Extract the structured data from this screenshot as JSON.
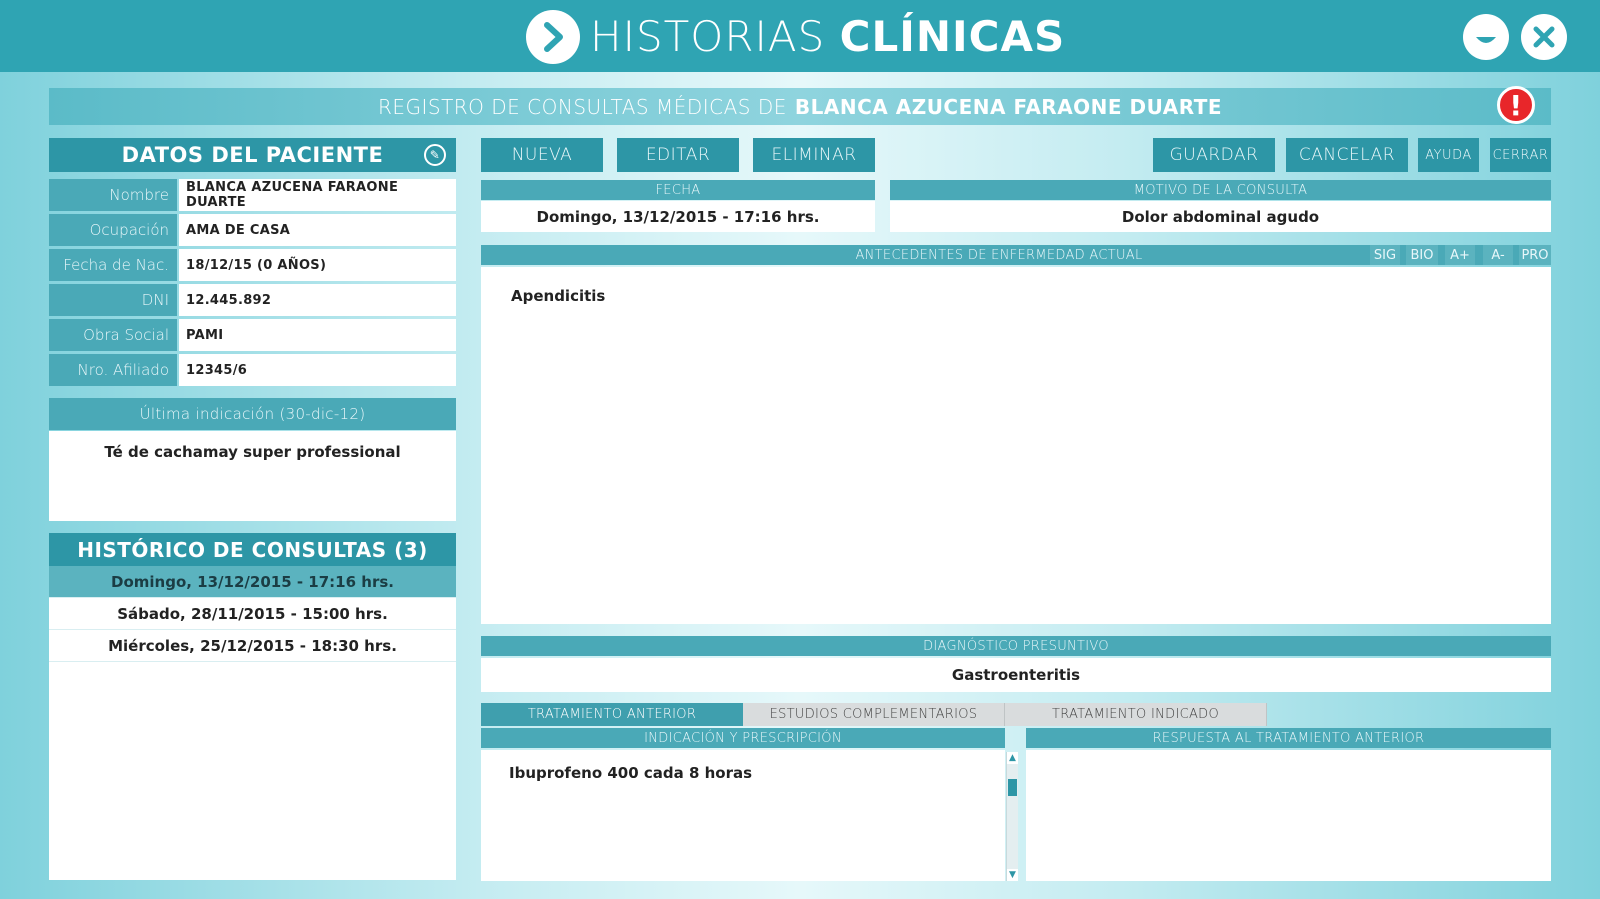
{
  "app": {
    "title_light": "HISTORIAS",
    "title_bold": "CLÍNICAS",
    "logo_icon": "chevron-right-icon",
    "minimize_icon": "minimize-icon",
    "close_icon": "close-icon"
  },
  "header": {
    "prefix": "REGISTRO DE CONSULTAS MÉDICAS DE",
    "patient_name": "BLANCA AZUCENA FARAONE DUARTE",
    "alert_symbol": "!"
  },
  "patient": {
    "title": "DATOS DEL PACIENTE",
    "fields": [
      {
        "label": "Nombre",
        "value": "BLANCA AZUCENA FARAONE DUARTE"
      },
      {
        "label": "Ocupación",
        "value": "AMA DE CASA"
      },
      {
        "label": "Fecha de Nac.",
        "value": "18/12/15 (0 AÑOS)"
      },
      {
        "label": "DNI",
        "value": "12.445.892"
      },
      {
        "label": "Obra Social",
        "value": "PAMI"
      },
      {
        "label": "Nro. Afiliado",
        "value": "12345/6"
      }
    ]
  },
  "last_indication": {
    "title": "Última indicación (30-dic-12)",
    "text": "Té de cachamay super professional"
  },
  "history": {
    "title": "HISTÓRICO DE CONSULTAS (3)",
    "items": [
      "Domingo, 13/12/2015 - 17:16 hrs.",
      "Sábado, 28/11/2015 - 15:00 hrs.",
      "Miércoles, 25/12/2015 - 18:30 hrs."
    ]
  },
  "toolbar": {
    "nueva": "NUEVA",
    "editar": "EDITAR",
    "eliminar": "ELIMINAR",
    "guardar": "GUARDAR",
    "cancelar": "CANCELAR",
    "ayuda": "AYUDA",
    "cerrar": "CERRAR"
  },
  "consulta": {
    "fecha_label": "FECHA",
    "fecha_value": "Domingo, 13/12/2015 - 17:16 hrs.",
    "motivo_label": "MOTIVO DE LA CONSULTA",
    "motivo_value": "Dolor abdominal agudo",
    "antecedentes_label": "ANTECEDENTES DE ENFERMEDAD ACTUAL",
    "antecedentes_value": "Apendicitis",
    "format_buttons": [
      "SIG",
      "BIO",
      "A+",
      "A-",
      "PRO"
    ],
    "diagnostico_label": "DIAGNÓSTICO PRESUNTIVO",
    "diagnostico_value": "Gastroenteritis"
  },
  "tabs": [
    "TRATAMIENTO ANTERIOR",
    "ESTUDIOS COMPLEMENTARIOS",
    "TRATAMIENTO INDICADO"
  ],
  "treatment": {
    "indicacion_label": "INDICACIÓN Y PRESCRIPCIÓN",
    "indicacion_value": "Ibuprofeno 400 cada 8 horas",
    "respuesta_label": "RESPUESTA AL TRATAMIENTO ANTERIOR",
    "respuesta_value": ""
  },
  "colors": {
    "primary": "#2fa4b3",
    "accent_dark": "#2d96a6",
    "alert": "#e8262a"
  }
}
